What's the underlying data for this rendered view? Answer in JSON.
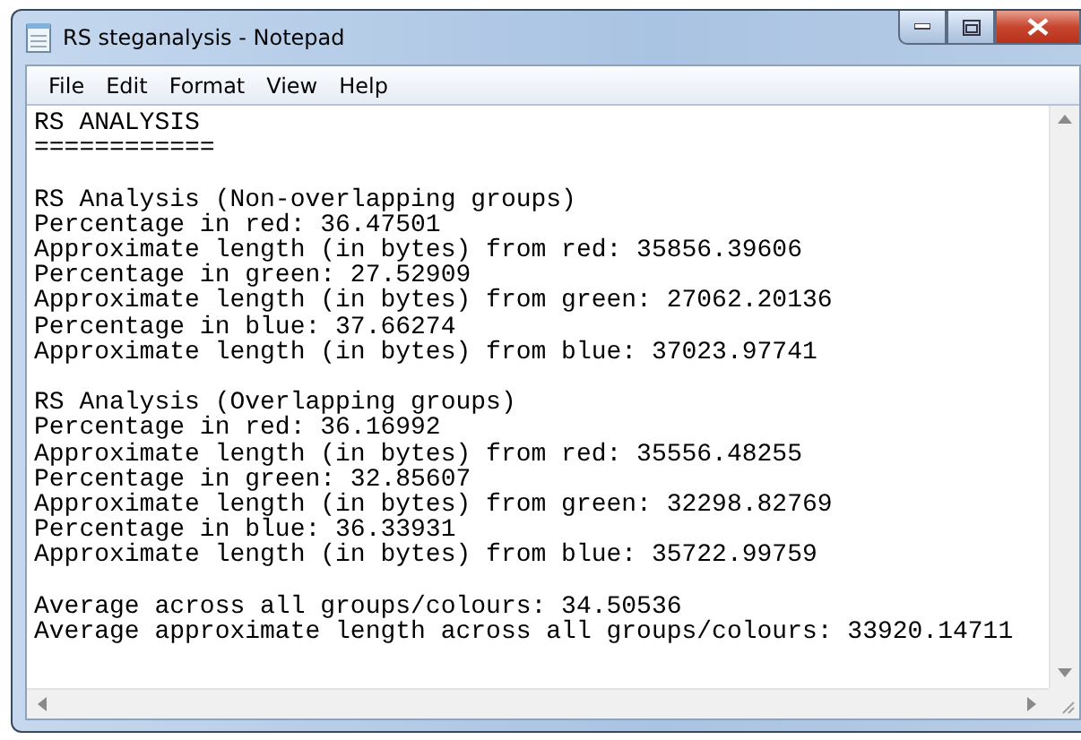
{
  "window": {
    "title": "RS steganalysis - Notepad"
  },
  "menu": [
    "File",
    "Edit",
    "Format",
    "View",
    "Help"
  ],
  "document": {
    "blocks": [
      [
        "RS ANALYSIS",
        "============"
      ],
      [
        "RS Analysis (Non-overlapping groups)",
        "Percentage in red: 36.47501",
        "Approximate length (in bytes) from red: 35856.39606",
        "Percentage in green: 27.52909",
        "Approximate length (in bytes) from green: 27062.20136",
        "Percentage in blue: 37.66274",
        "Approximate length (in bytes) from blue: 37023.97741"
      ],
      [
        "RS Analysis (Overlapping groups)",
        "Percentage in red: 36.16992",
        "Approximate length (in bytes) from red: 35556.48255",
        "Percentage in green: 32.85607",
        "Approximate length (in bytes) from green: 32298.82769",
        "Percentage in blue: 36.33931",
        "Approximate length (in bytes) from blue: 35722.99759"
      ],
      [
        "Average across all groups/colours: 34.50536",
        "Average approximate length across all groups/colours: 33920.14711"
      ]
    ]
  }
}
